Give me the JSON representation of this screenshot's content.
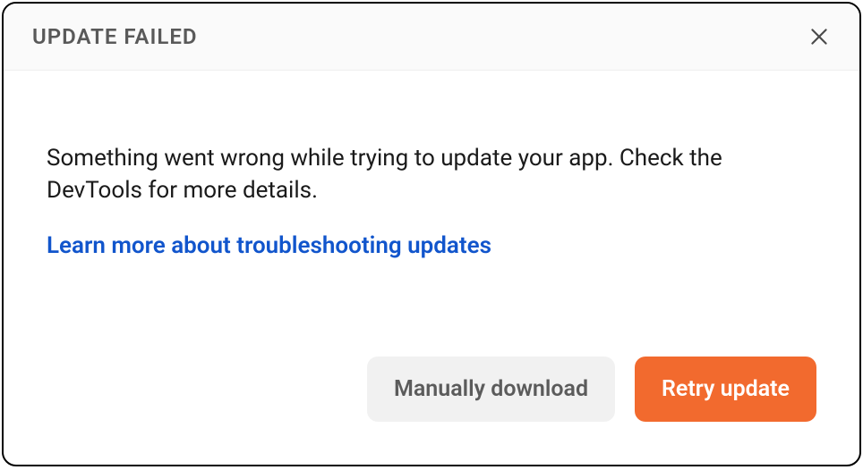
{
  "dialog": {
    "title": "UPDATE FAILED",
    "body": {
      "message": "Something went wrong while trying to update your app. Check the DevTools for more details.",
      "learn_more_label": "Learn more about troubleshooting updates"
    },
    "footer": {
      "secondary_label": "Manually download",
      "primary_label": "Retry update"
    }
  }
}
